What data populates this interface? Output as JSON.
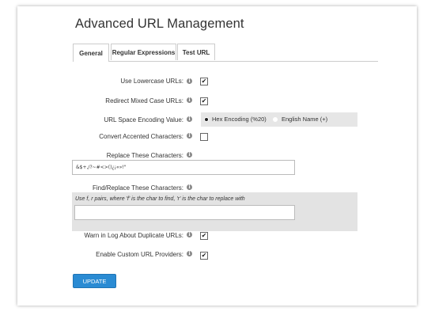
{
  "page": {
    "title": "Advanced URL Management"
  },
  "tabs": [
    {
      "label": "General",
      "active": true
    },
    {
      "label": "Regular Expressions",
      "active": false
    },
    {
      "label": "Test URL",
      "active": false
    }
  ],
  "fields": {
    "lowercase": {
      "label": "Use Lowercase URLs:",
      "checked": true
    },
    "redirect_mixed": {
      "label": "Redirect Mixed Case URLs:",
      "checked": true
    },
    "space_encoding": {
      "label": "URL Space Encoding Value:",
      "options": [
        "Hex Encoding (%20)",
        "English Name (+)"
      ],
      "selected": "Hex Encoding (%20)"
    },
    "convert_accented": {
      "label": "Convert Accented Characters:",
      "checked": false
    },
    "replace_chars": {
      "label": "Replace These Characters:",
      "value": "&$+,/?~#<>()¿¡«»!\""
    },
    "find_replace": {
      "label": "Find/Replace These Characters:",
      "hint": "Use f, r pairs, where 'f' is the char to find, 'r' is the char to replace with",
      "value": ""
    },
    "warn_duplicates": {
      "label": "Warn in Log About Duplicate URLs:",
      "checked": true
    },
    "custom_providers": {
      "label": "Enable Custom URL Providers:",
      "checked": true
    }
  },
  "info_icon_glyph": "i",
  "check_glyph": "✔",
  "update_button": {
    "label": "UPDATE"
  },
  "colors": {
    "accent": "#2a8bd3",
    "radio_bg": "#e6e6e6",
    "hint_bg": "#e3e3e3"
  }
}
